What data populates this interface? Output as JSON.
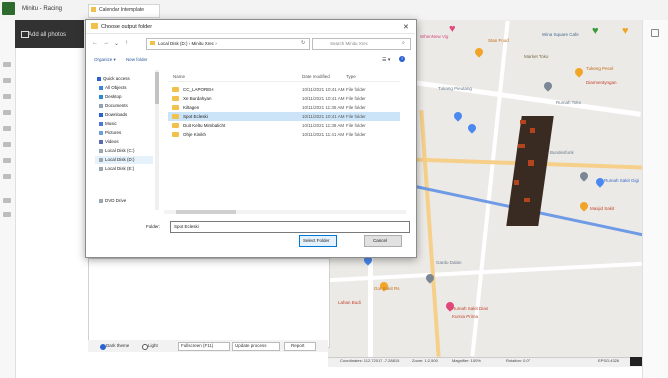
{
  "app": {
    "title": "Minitu - Racing",
    "tab_label": "Calendar Intemplate",
    "side_label": "Add all photos"
  },
  "dialog": {
    "title": "Choose output folder",
    "address": "Local Disk (D:) › Minitu Xrec ›",
    "search_placeholder": "Search Minitu Xrec",
    "organize": "Organize ▾",
    "new_folder": "New folder",
    "columns": {
      "name": "Name",
      "date": "Date modified",
      "type": "Type"
    },
    "nav_items": [
      "Quick access",
      "All Objects",
      "Desktop",
      "Documents",
      "Downloads",
      "Music",
      "Pictures",
      "Videos",
      "Local Disk (C:)",
      "Local Disk (D:)",
      "Local Disk (E:)",
      "DVD Drive"
    ],
    "rows": [
      {
        "name": "CC_LAPOREH",
        "date": "10/11/2021 10:41 AM",
        "type": "File folder",
        "selected": false
      },
      {
        "name": "Xe Burdahyan",
        "date": "10/11/2021 10:41 AM",
        "type": "File folder",
        "selected": false
      },
      {
        "name": "Kiltagen",
        "date": "10/11/2021 11:35 AM",
        "type": "File folder",
        "selected": false
      },
      {
        "name": "Spot Ecleski",
        "date": "10/11/2021 10:41 AM",
        "type": "File folder",
        "selected": true
      },
      {
        "name": "Duit Keltu Mimbalicht",
        "date": "10/11/2021 11:38 AM",
        "type": "File folder",
        "selected": false
      },
      {
        "name": "Ohje Kinikh",
        "date": "10/11/2021 11:41 AM",
        "type": "File folder",
        "selected": false
      }
    ],
    "folder_label": "Folder:",
    "folder_value": "Spot Ecleski",
    "select_button": "Select Folder",
    "cancel_button": "Cancel"
  },
  "map": {
    "places": [
      "WhenNew Vig",
      "Stan Food",
      "Market Toko",
      "Wina Square Cafe",
      "Tukeng Pecel",
      "Diarmentyngan",
      "Tukang Pieutang",
      "Rumah Toko",
      "Rumah Sakit Gigi",
      "Bundesfunk",
      "Masjid Sakit",
      "Gardu Dalan",
      "Gor Sakit Rs",
      "Lahan Budi",
      "Rumah Sakit Dian",
      "Kurnia Prima"
    ]
  },
  "bottom_bar": {
    "option_a": "Dark theme",
    "option_b": "Light",
    "option_c": "Fullscreen (F11)",
    "option_d": "Update process",
    "option_e": "Report"
  },
  "status_bar": {
    "coords": "Coordinates: 112.72017 -7.28815",
    "zoom": "Zoom: 1:2,500",
    "scale": "Magnifier: 100%",
    "rotation": "Rotation: 0.0°",
    "crs": "EPSG:4326"
  },
  "colors": {
    "accent": "#0078d7",
    "folder": "#f1c14b",
    "selection": "#cce4f7",
    "building": "#3a2b22",
    "route": "#6f9be6"
  }
}
